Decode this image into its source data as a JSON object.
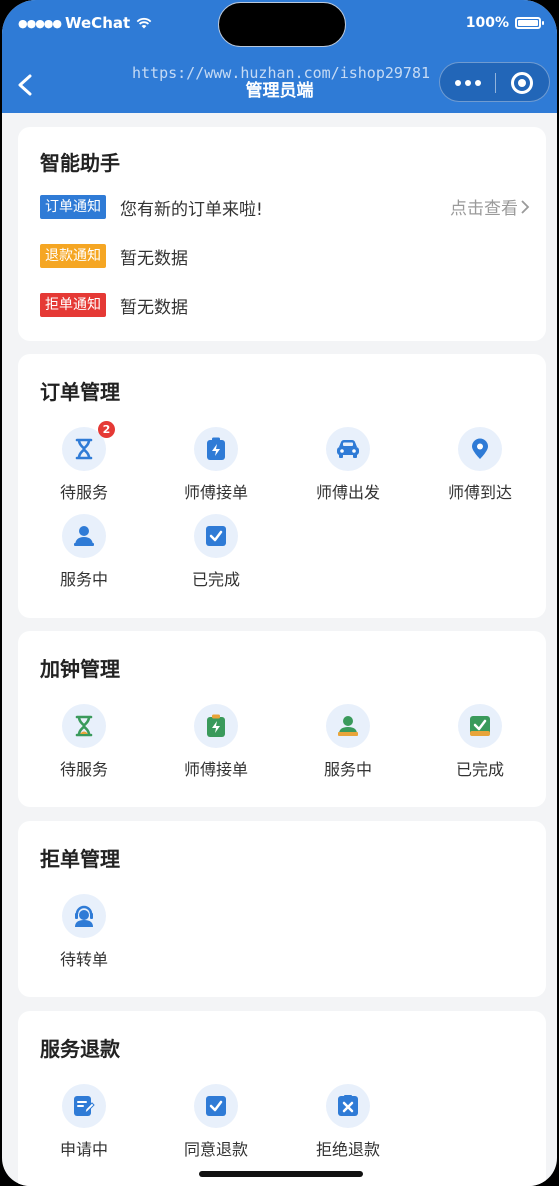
{
  "status": {
    "carrier": "WeChat",
    "battery": "100%"
  },
  "nav": {
    "title": "管理员端",
    "watermark": "https://www.huzhan.com/ishop29781"
  },
  "assistant": {
    "title": "智能助手",
    "notices": [
      {
        "tag": "订单通知",
        "tag_color": "#2f7bd6",
        "text": "您有新的订单来啦!",
        "action": "点击查看"
      },
      {
        "tag": "退款通知",
        "tag_color": "#f5a623",
        "text": "暂无数据"
      },
      {
        "tag": "拒单通知",
        "tag_color": "#e53935",
        "text": "暂无数据"
      }
    ]
  },
  "order_mgmt": {
    "title": "订单管理",
    "items": [
      {
        "label": "待服务",
        "icon": "hourglass-icon",
        "badge": "2"
      },
      {
        "label": "师傅接单",
        "icon": "lightning-clipboard-icon"
      },
      {
        "label": "师傅出发",
        "icon": "car-icon"
      },
      {
        "label": "师傅到达",
        "icon": "location-pin-icon"
      },
      {
        "label": "服务中",
        "icon": "person-icon"
      },
      {
        "label": "已完成",
        "icon": "check-box-icon"
      }
    ]
  },
  "extra_mgmt": {
    "title": "加钟管理",
    "items": [
      {
        "label": "待服务",
        "icon": "hourglass-icon"
      },
      {
        "label": "师傅接单",
        "icon": "lightning-clipboard-icon"
      },
      {
        "label": "服务中",
        "icon": "person-icon"
      },
      {
        "label": "已完成",
        "icon": "check-box-icon"
      }
    ]
  },
  "reject_mgmt": {
    "title": "拒单管理",
    "items": [
      {
        "label": "待转单",
        "icon": "agent-icon"
      }
    ]
  },
  "refund": {
    "title": "服务退款",
    "items": [
      {
        "label": "申请中",
        "icon": "edit-doc-icon"
      },
      {
        "label": "同意退款",
        "icon": "approve-box-icon"
      },
      {
        "label": "拒绝退款",
        "icon": "reject-box-icon"
      }
    ]
  },
  "colors": {
    "primary": "#2f7bd6",
    "green": "#3a9a5b",
    "orange": "#e8a43a",
    "red": "#e53935"
  }
}
